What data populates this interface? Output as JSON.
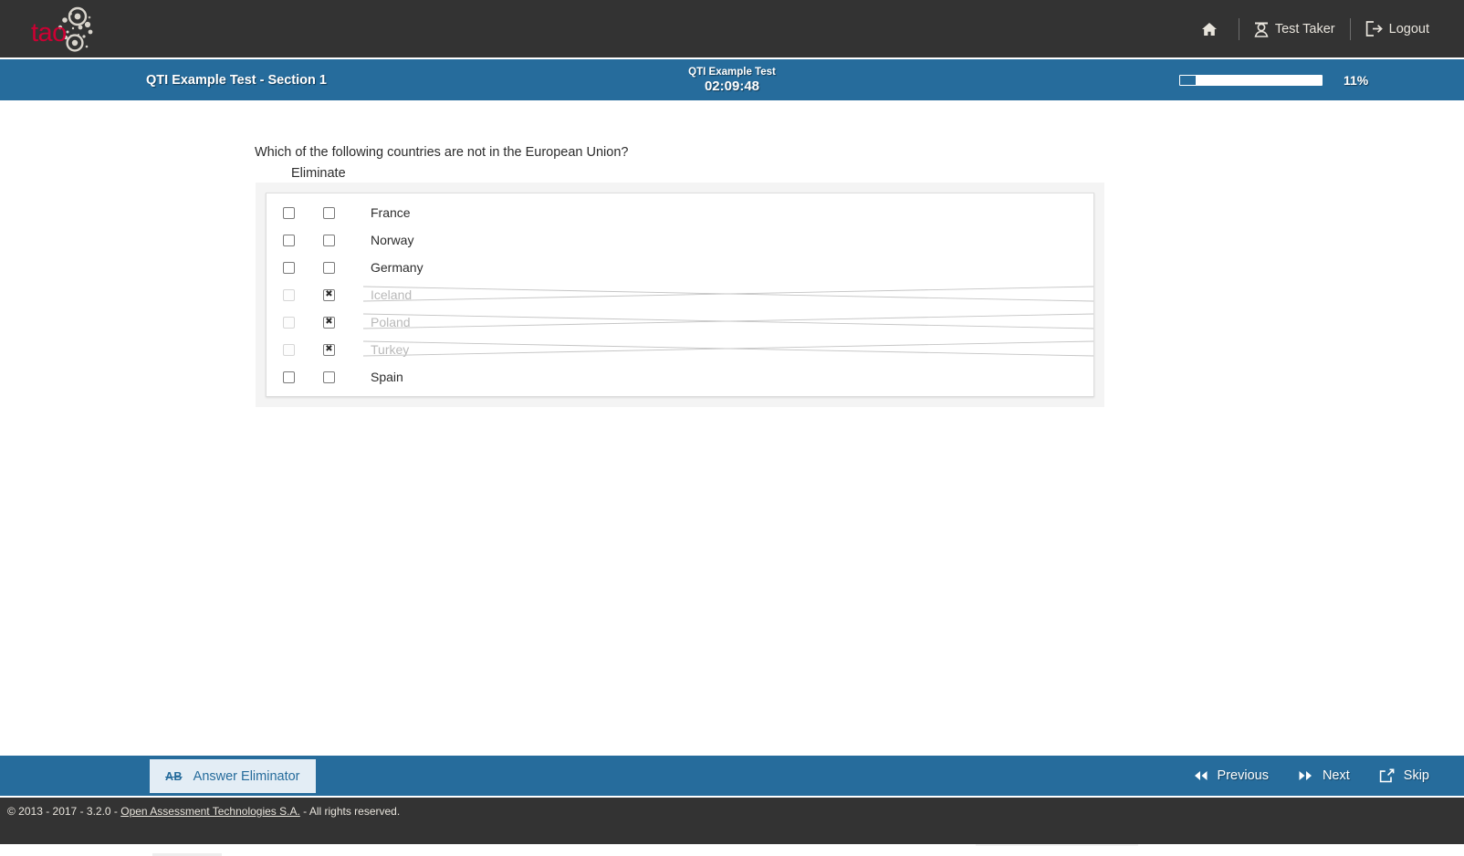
{
  "header": {
    "logo_text": "tao",
    "nav": [
      {
        "label": "",
        "icon": "home-icon"
      },
      {
        "label": "Test Taker",
        "icon": "user-icon"
      },
      {
        "label": "Logout",
        "icon": "logout-icon"
      }
    ]
  },
  "testbar": {
    "section_title": "QTI Example Test - Section 1",
    "timer_label": "QTI Example Test",
    "timer_value": "02:09:48",
    "progress_percent": 11,
    "progress_text": "11%",
    "accent_color": "#266c9c"
  },
  "question": {
    "prompt": "Which of the following countries are not in the European Union?",
    "eliminate_header": "Eliminate",
    "choices": [
      {
        "label": "France",
        "selected": false,
        "eliminated": false
      },
      {
        "label": "Norway",
        "selected": false,
        "eliminated": false
      },
      {
        "label": "Germany",
        "selected": false,
        "eliminated": false
      },
      {
        "label": "Iceland",
        "selected": false,
        "eliminated": true
      },
      {
        "label": "Poland",
        "selected": false,
        "eliminated": true
      },
      {
        "label": "Turkey",
        "selected": false,
        "eliminated": true
      },
      {
        "label": "Spain",
        "selected": false,
        "eliminated": false
      }
    ],
    "eliminate_mark": "✖"
  },
  "toolbar": {
    "answer_eliminator_label": "Answer Eliminator",
    "answer_eliminator_icon_text": "AB",
    "previous_label": "Previous",
    "next_label": "Next",
    "skip_label": "Skip"
  },
  "footer": {
    "prefix": "© 2013 - 2017 - 3.2.0 - ",
    "link": "Open Assessment Technologies S.A.",
    "suffix": " - All rights reserved."
  }
}
